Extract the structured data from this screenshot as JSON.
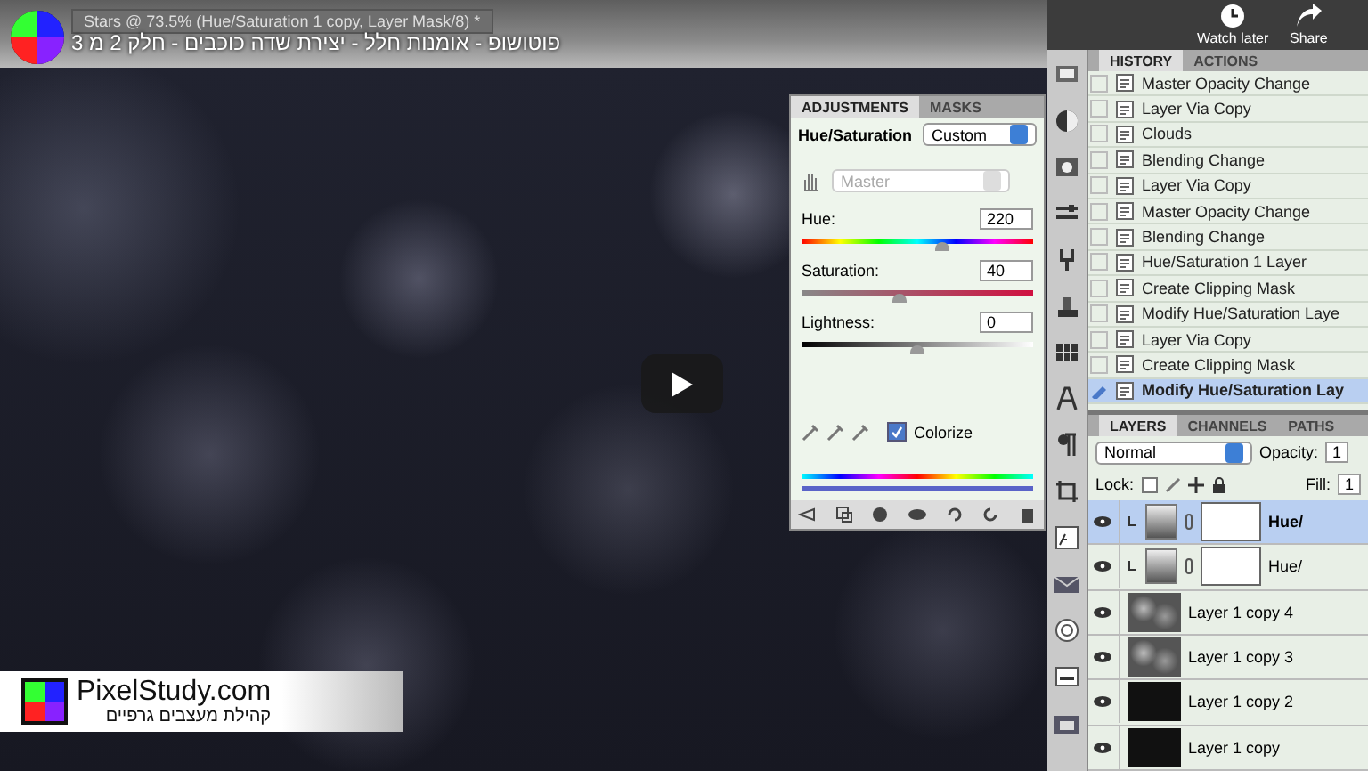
{
  "video": {
    "title": "פוטושופ - אומנות חלל - יצירת שדה כוכבים - חלק 2 מ 3",
    "actions": [
      {
        "label": "Watch later",
        "kind": "clock"
      },
      {
        "label": "Share",
        "kind": "share"
      }
    ]
  },
  "document_tab": {
    "title": "Stars @ 73.5% (Hue/Saturation 1 copy, Layer Mask/8) *"
  },
  "adjustments": {
    "tabs": [
      {
        "label": "ADJUSTMENTS",
        "selected": true
      },
      {
        "label": "MASKS",
        "selected": false
      }
    ],
    "title": "Hue/Saturation",
    "preset": "Custom",
    "channel": "Master",
    "sliders": [
      {
        "label": "Hue:",
        "value": "220",
        "level": 0.61,
        "kind": "hue"
      },
      {
        "label": "Saturation:",
        "value": "40",
        "level": 0.42,
        "kind": "saturation"
      },
      {
        "label": "Lightness:",
        "value": "0",
        "level": 0.5,
        "kind": "lightness"
      }
    ],
    "colorize": {
      "label": "Colorize",
      "checked": true
    }
  },
  "history": {
    "tabs": [
      {
        "label": "HISTORY",
        "selected": true
      },
      {
        "label": "ACTIONS",
        "selected": false
      }
    ],
    "items": [
      {
        "label": "Master Opacity Change",
        "selected": false
      },
      {
        "label": "Layer Via Copy",
        "selected": false
      },
      {
        "label": "Clouds",
        "selected": false
      },
      {
        "label": "Blending Change",
        "selected": false
      },
      {
        "label": "Layer Via Copy",
        "selected": false
      },
      {
        "label": "Master Opacity Change",
        "selected": false
      },
      {
        "label": "Blending Change",
        "selected": false
      },
      {
        "label": "Hue/Saturation 1 Layer",
        "selected": false
      },
      {
        "label": "Create Clipping Mask",
        "selected": false
      },
      {
        "label": "Modify Hue/Saturation Laye",
        "selected": false
      },
      {
        "label": "Layer Via Copy",
        "selected": false
      },
      {
        "label": "Create Clipping Mask",
        "selected": false
      },
      {
        "label": "Modify Hue/Saturation Lay",
        "selected": true
      }
    ]
  },
  "layers": {
    "tabs": [
      {
        "label": "LAYERS",
        "selected": true
      },
      {
        "label": "CHANNELS",
        "selected": false
      },
      {
        "label": "PATHS",
        "selected": false
      }
    ],
    "blend_mode": "Normal",
    "opacity_label": "Opacity:",
    "opacity_value": "1",
    "lock_label": "Lock:",
    "fill_label": "Fill:",
    "fill_value": "1",
    "items": [
      {
        "name": "Hue/",
        "kind": "adjustment",
        "selected": true
      },
      {
        "name": "Hue/",
        "kind": "adjustment",
        "selected": false
      },
      {
        "name": "Layer 1 copy 4",
        "kind": "texture",
        "selected": false
      },
      {
        "name": "Layer 1 copy 3",
        "kind": "texture",
        "selected": false
      },
      {
        "name": "Layer 1 copy 2",
        "kind": "black",
        "selected": false
      },
      {
        "name": "Layer 1 copy",
        "kind": "black",
        "selected": false
      }
    ]
  },
  "branding": {
    "site": "PixelStudy.com",
    "tagline": "קהילת מעצבים גרפיים"
  }
}
